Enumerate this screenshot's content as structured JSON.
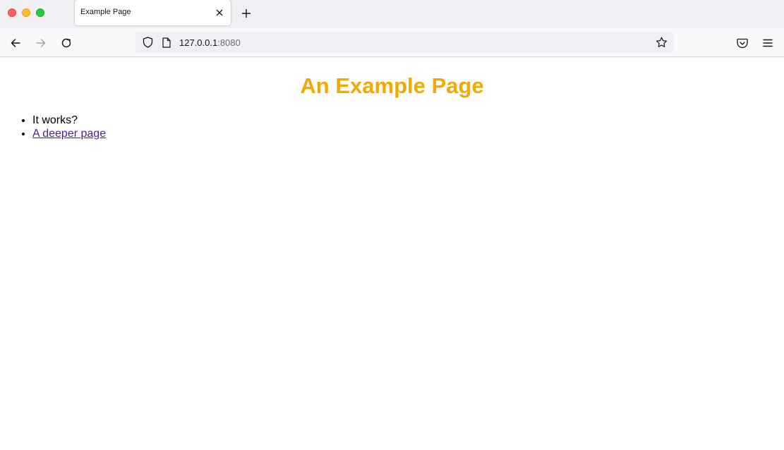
{
  "browser": {
    "tab": {
      "title": "Example Page"
    },
    "url": {
      "host": "127.0.0.1",
      "port": ":8080"
    }
  },
  "icons": {
    "window_controls": [
      "close-dot",
      "minimize-dot",
      "zoom-dot"
    ],
    "tab": [
      "close-icon",
      "plus-icon"
    ],
    "nav": [
      "back-arrow-icon",
      "forward-arrow-icon",
      "reload-icon",
      "shield-icon",
      "page-icon",
      "star-icon",
      "pocket-icon",
      "hamburger-menu-icon"
    ]
  },
  "page": {
    "heading": "An Example Page",
    "heading_color": "#f2a900",
    "items": [
      {
        "text": "It works?"
      },
      {
        "link_text": "A deeper page",
        "link_color": "#551a8b"
      }
    ]
  }
}
